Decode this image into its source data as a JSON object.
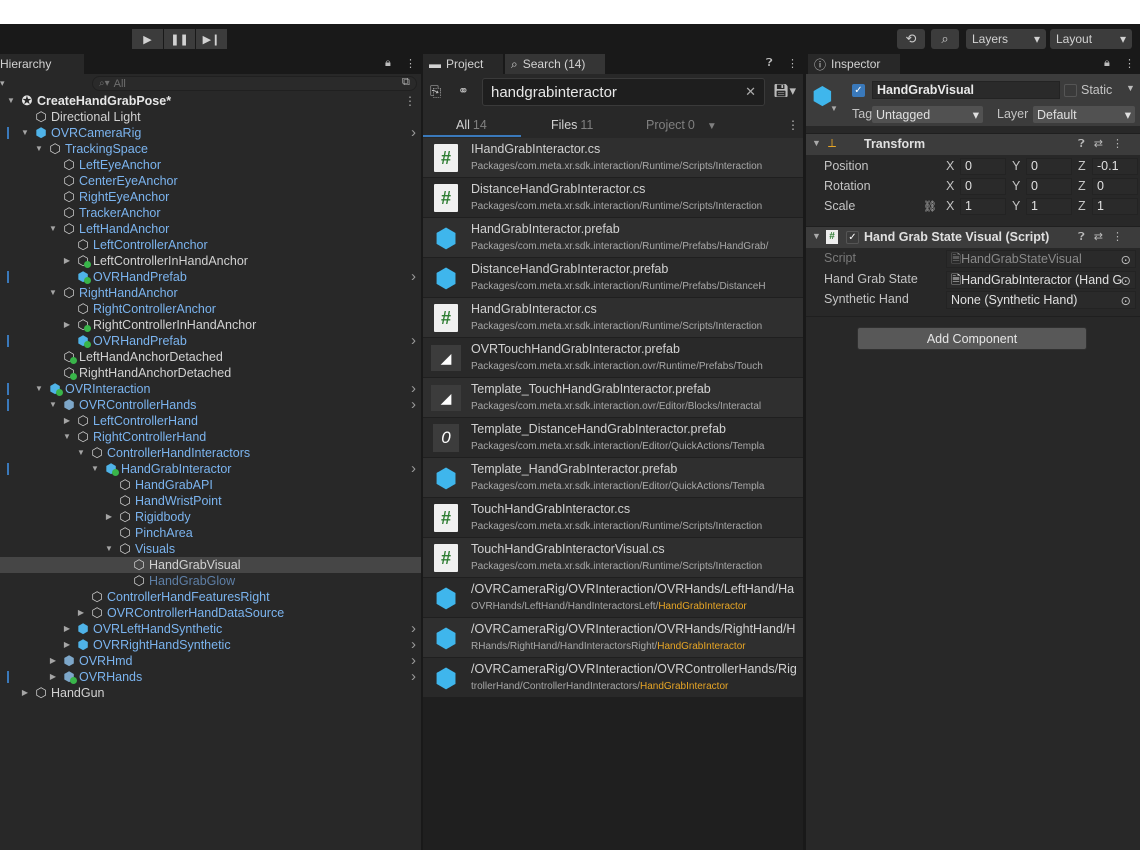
{
  "toolbar": {
    "play_icon": "play-icon",
    "pause_icon": "pause-icon",
    "step_icon": "step-icon",
    "history_icon": "history-icon",
    "search_icon": "search-icon",
    "layers_label": "Layers",
    "layout_label": "Layout"
  },
  "hierarchy": {
    "tab_label": "Hierarchy",
    "search_placeholder": "All",
    "rows": [
      {
        "label": "CreateHandGrabPose*",
        "depth": 0,
        "arrow": "down",
        "icon": "scene",
        "style": "bold",
        "more": true
      },
      {
        "label": "Directional Light",
        "depth": 1,
        "arrow": "",
        "icon": "cube-outline",
        "style": "white"
      },
      {
        "label": "OVRCameraRig",
        "depth": 1,
        "arrow": "down",
        "icon": "cube-blue",
        "style": "blue",
        "bar": true,
        "chev": true
      },
      {
        "label": "TrackingSpace",
        "depth": 2,
        "arrow": "down",
        "icon": "cube-outline",
        "style": "blue"
      },
      {
        "label": "LeftEyeAnchor",
        "depth": 3,
        "arrow": "",
        "icon": "cube-outline",
        "style": "blue"
      },
      {
        "label": "CenterEyeAnchor",
        "depth": 3,
        "arrow": "",
        "icon": "cube-outline",
        "style": "blue"
      },
      {
        "label": "RightEyeAnchor",
        "depth": 3,
        "arrow": "",
        "icon": "cube-outline",
        "style": "blue"
      },
      {
        "label": "TrackerAnchor",
        "depth": 3,
        "arrow": "",
        "icon": "cube-outline",
        "style": "blue"
      },
      {
        "label": "LeftHandAnchor",
        "depth": 3,
        "arrow": "down",
        "icon": "cube-outline",
        "style": "blue"
      },
      {
        "label": "LeftControllerAnchor",
        "depth": 4,
        "arrow": "",
        "icon": "cube-outline",
        "style": "blue"
      },
      {
        "label": "LeftControllerInHandAnchor",
        "depth": 4,
        "arrow": "right",
        "icon": "cube-green",
        "style": "white"
      },
      {
        "label": "OVRHandPrefab",
        "depth": 4,
        "arrow": "",
        "icon": "cube-blue-green",
        "style": "blue",
        "bar": true,
        "chev": true
      },
      {
        "label": "RightHandAnchor",
        "depth": 3,
        "arrow": "down",
        "icon": "cube-outline",
        "style": "blue"
      },
      {
        "label": "RightControllerAnchor",
        "depth": 4,
        "arrow": "",
        "icon": "cube-outline",
        "style": "blue"
      },
      {
        "label": "RightControllerInHandAnchor",
        "depth": 4,
        "arrow": "right",
        "icon": "cube-green",
        "style": "white"
      },
      {
        "label": "OVRHandPrefab",
        "depth": 4,
        "arrow": "",
        "icon": "cube-blue-green",
        "style": "blue",
        "bar": true,
        "chev": true
      },
      {
        "label": "LeftHandAnchorDetached",
        "depth": 3,
        "arrow": "",
        "icon": "cube-green",
        "style": "white"
      },
      {
        "label": "RightHandAnchorDetached",
        "depth": 3,
        "arrow": "",
        "icon": "cube-green",
        "style": "white"
      },
      {
        "label": "OVRInteraction",
        "depth": 2,
        "arrow": "down",
        "icon": "cube-blue-green",
        "style": "blue",
        "bar": true,
        "chev": true
      },
      {
        "label": "OVRControllerHands",
        "depth": 3,
        "arrow": "down",
        "icon": "cube-striped",
        "style": "blue",
        "bar": true,
        "chev": true
      },
      {
        "label": "LeftControllerHand",
        "depth": 4,
        "arrow": "right",
        "icon": "cube-outline",
        "style": "blue"
      },
      {
        "label": "RightControllerHand",
        "depth": 4,
        "arrow": "down",
        "icon": "cube-outline",
        "style": "blue"
      },
      {
        "label": "ControllerHandInteractors",
        "depth": 5,
        "arrow": "down",
        "icon": "cube-outline",
        "style": "blue"
      },
      {
        "label": "HandGrabInteractor",
        "depth": 6,
        "arrow": "down",
        "icon": "cube-blue-green",
        "style": "blue",
        "bar": true,
        "chev": true
      },
      {
        "label": "HandGrabAPI",
        "depth": 7,
        "arrow": "",
        "icon": "cube-outline",
        "style": "blue"
      },
      {
        "label": "HandWristPoint",
        "depth": 7,
        "arrow": "",
        "icon": "cube-outline",
        "style": "blue"
      },
      {
        "label": "Rigidbody",
        "depth": 7,
        "arrow": "right",
        "icon": "cube-outline",
        "style": "blue"
      },
      {
        "label": "PinchArea",
        "depth": 7,
        "arrow": "",
        "icon": "cube-outline",
        "style": "blue"
      },
      {
        "label": "Visuals",
        "depth": 7,
        "arrow": "down",
        "icon": "cube-outline",
        "style": "blue"
      },
      {
        "label": "HandGrabVisual",
        "depth": 8,
        "arrow": "",
        "icon": "cube-outline",
        "style": "white",
        "selected": true
      },
      {
        "label": "HandGrabGlow",
        "depth": 8,
        "arrow": "",
        "icon": "cube-outline",
        "style": "dim"
      },
      {
        "label": "ControllerHandFeaturesRight",
        "depth": 5,
        "arrow": "",
        "icon": "cube-outline",
        "style": "blue"
      },
      {
        "label": "OVRControllerHandDataSource",
        "depth": 5,
        "arrow": "right",
        "icon": "cube-outline",
        "style": "blue"
      },
      {
        "label": "OVRLeftHandSynthetic",
        "depth": 4,
        "arrow": "right",
        "icon": "cube-blue",
        "style": "blue",
        "chev": true
      },
      {
        "label": "OVRRightHandSynthetic",
        "depth": 4,
        "arrow": "right",
        "icon": "cube-blue",
        "style": "blue",
        "chev": true
      },
      {
        "label": "OVRHmd",
        "depth": 3,
        "arrow": "right",
        "icon": "cube-striped",
        "style": "blue",
        "chev": true
      },
      {
        "label": "OVRHands",
        "depth": 3,
        "arrow": "right",
        "icon": "cube-striped-green",
        "style": "blue",
        "bar": true,
        "chev": true
      },
      {
        "label": "HandGun",
        "depth": 1,
        "arrow": "right",
        "icon": "cube-outline",
        "style": "white"
      }
    ]
  },
  "project": {
    "tab_project": "Project",
    "tab_search": "Search (14)",
    "search_value": "handgrabinteractor",
    "filter_tabs": [
      {
        "label": "All",
        "count": "14"
      },
      {
        "label": "Files",
        "count": "11"
      },
      {
        "label": "Project",
        "count": "0"
      }
    ],
    "results": [
      {
        "name": "IHandGrabInteractor.cs",
        "path": "Packages/com.meta.xr.sdk.interaction/Runtime/Scripts/Interaction",
        "hl": "",
        "icon": "script-icon"
      },
      {
        "name": "DistanceHandGrabInteractor.cs",
        "path": "Packages/com.meta.xr.sdk.interaction/Runtime/Scripts/Interaction",
        "hl": "",
        "icon": "script-icon"
      },
      {
        "name": "HandGrabInteractor.prefab",
        "path": "Packages/com.meta.xr.sdk.interaction/Runtime/Prefabs/HandGrab/",
        "hl": "",
        "icon": "prefab-icon"
      },
      {
        "name": "DistanceHandGrabInteractor.prefab",
        "path": "Packages/com.meta.xr.sdk.interaction/Runtime/Prefabs/DistanceH",
        "hl": "",
        "icon": "prefab-icon"
      },
      {
        "name": "HandGrabInteractor.cs",
        "path": "Packages/com.meta.xr.sdk.interaction/Runtime/Scripts/Interaction",
        "hl": "",
        "icon": "script-icon"
      },
      {
        "name": "OVRTouchHandGrabInteractor.prefab",
        "path": "Packages/com.meta.xr.sdk.interaction.ovr/Runtime/Prefabs/Touch",
        "hl": "",
        "icon": "plane-icon"
      },
      {
        "name": "Template_TouchHandGrabInteractor.prefab",
        "path": "Packages/com.meta.xr.sdk.interaction.ovr/Editor/Blocks/Interactal",
        "hl": "",
        "icon": "plane-icon"
      },
      {
        "name": "Template_DistanceHandGrabInteractor.prefab",
        "path": "Packages/com.meta.xr.sdk.interaction/Editor/QuickActions/Templa",
        "hl": "",
        "icon": "ring-icon"
      },
      {
        "name": "Template_HandGrabInteractor.prefab",
        "path": "Packages/com.meta.xr.sdk.interaction/Editor/QuickActions/Templa",
        "hl": "",
        "icon": "prefab-icon"
      },
      {
        "name": "TouchHandGrabInteractor.cs",
        "path": "Packages/com.meta.xr.sdk.interaction/Runtime/Scripts/Interaction",
        "hl": "",
        "icon": "script-icon"
      },
      {
        "name": "TouchHandGrabInteractorVisual.cs",
        "path": "Packages/com.meta.xr.sdk.interaction/Runtime/Scripts/Interaction",
        "hl": "",
        "icon": "script-icon"
      },
      {
        "name": "/OVRCameraRig/OVRInteraction/OVRHands/LeftHand/Ha",
        "path": "OVRHands/LeftHand/HandInteractorsLeft/",
        "hl": "HandGrabInteractor",
        "icon": "prefab-icon"
      },
      {
        "name": "/OVRCameraRig/OVRInteraction/OVRHands/RightHand/H",
        "path": "RHands/RightHand/HandInteractorsRight/",
        "hl": "HandGrabInteractor",
        "icon": "prefab-icon"
      },
      {
        "name": "/OVRCameraRig/OVRInteraction/OVRControllerHands/Rig",
        "path": "trollerHand/ControllerHandInteractors/",
        "hl": "HandGrabInteractor",
        "icon": "prefab-icon"
      }
    ]
  },
  "inspector": {
    "tab_label": "Inspector",
    "object_name": "HandGrabVisual",
    "static_label": "Static",
    "tag_label": "Tag",
    "tag_value": "Untagged",
    "layer_label": "Layer",
    "layer_value": "Default",
    "transform": {
      "title": "Transform",
      "position_label": "Position",
      "rotation_label": "Rotation",
      "scale_label": "Scale",
      "position": {
        "x": "0",
        "y": "0",
        "z": "-0.1"
      },
      "rotation": {
        "x": "0",
        "y": "0",
        "z": "0"
      },
      "scale": {
        "x": "1",
        "y": "1",
        "z": "1"
      }
    },
    "component": {
      "title": "Hand Grab State Visual (Script)",
      "script_label": "Script",
      "script_value": "HandGrabStateVisual",
      "state_label": "Hand Grab State",
      "state_value": "HandGrabInteractor (Hand G",
      "synth_label": "Synthetic Hand",
      "synth_value": "None (Synthetic Hand)"
    },
    "add_component": "Add Component"
  }
}
